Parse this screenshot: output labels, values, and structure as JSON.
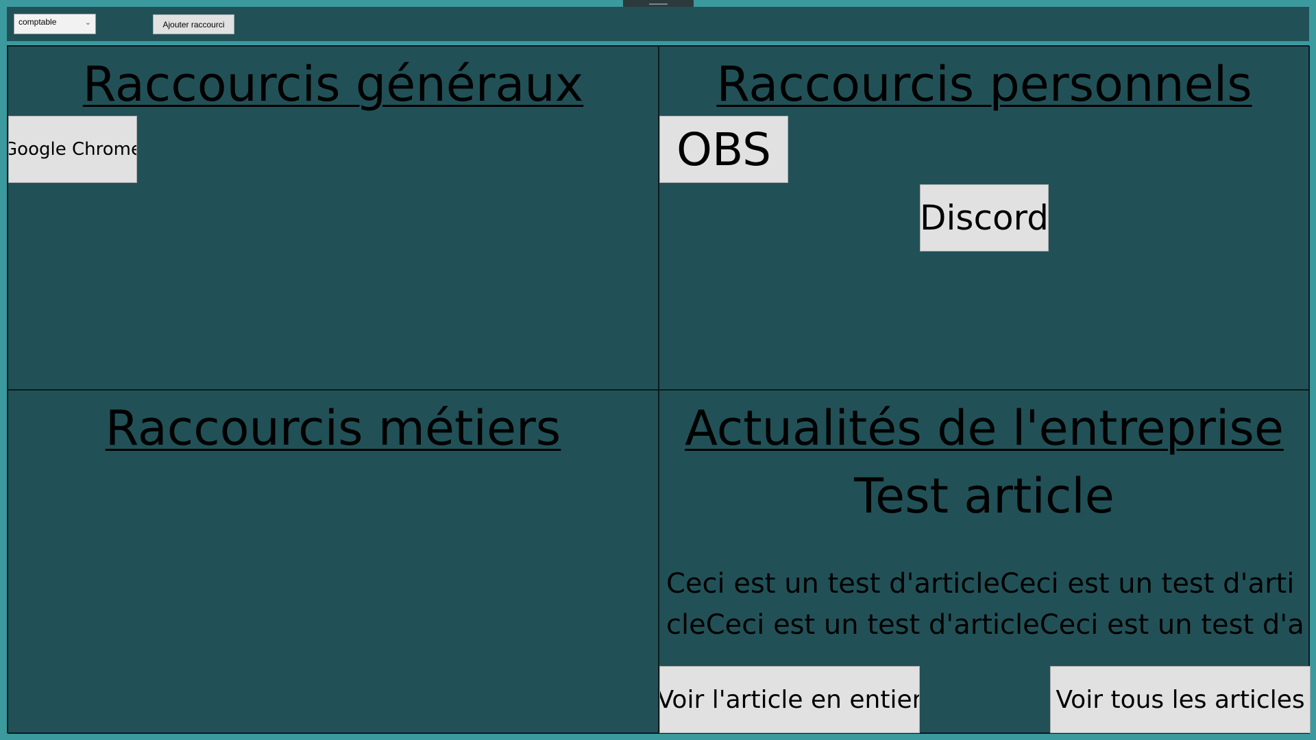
{
  "toolbar": {
    "role_selected": "comptable",
    "add_shortcut_label": "Ajouter raccourci"
  },
  "general": {
    "title": "Raccourcis généraux",
    "shortcuts": [
      "Google Chrome"
    ]
  },
  "personal": {
    "title": "Raccourcis personnels",
    "shortcuts": [
      "OBS",
      "Discord"
    ]
  },
  "metier": {
    "title": "Raccourcis métiers"
  },
  "news": {
    "title": "Actualités de l'entreprise",
    "article_title": "Test article",
    "article_body": "Ceci est un test d'articleCeci est un test d'articleCeci est un test d'articleCeci est un test d'art",
    "read_article_label": "Voir l'article en entier",
    "all_articles_label": "Voir tous les articles"
  },
  "icons": {
    "dropdown": "chevron-down-icon"
  }
}
